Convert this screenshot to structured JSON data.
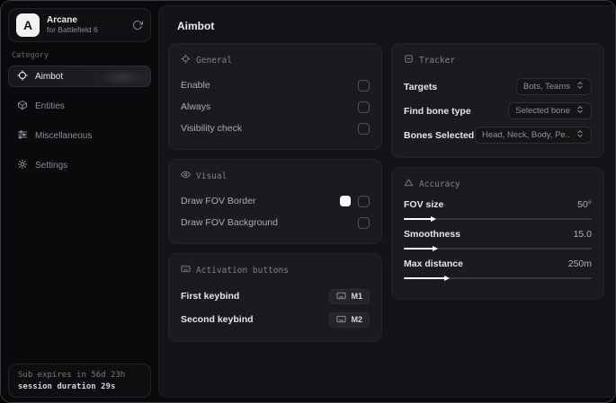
{
  "app": {
    "logo_letter": "A",
    "name": "Arcane",
    "subtitle": "for Battlefield 6"
  },
  "sidebar": {
    "category_label": "Category",
    "items": [
      {
        "label": "Aimbot",
        "icon": "crosshair-icon",
        "active": true
      },
      {
        "label": "Entities",
        "icon": "entities-icon",
        "active": false
      },
      {
        "label": "Miscellaneous",
        "icon": "sliders-icon",
        "active": false
      },
      {
        "label": "Settings",
        "icon": "gear-icon",
        "active": false
      }
    ],
    "footer": {
      "line1": "Sub expires in 56d 23h",
      "line2": "session duration 29s"
    }
  },
  "main": {
    "title": "Aimbot",
    "cards": {
      "general": {
        "title": "General",
        "rows": [
          {
            "label": "Enable",
            "control": "checkbox",
            "checked": false
          },
          {
            "label": "Always",
            "control": "checkbox",
            "checked": false
          },
          {
            "label": "Visibility check",
            "control": "checkbox",
            "checked": false
          }
        ]
      },
      "visual": {
        "title": "Visual",
        "rows": [
          {
            "label": "Draw FOV Border",
            "control": "color+checkbox",
            "color": "#ffffff",
            "checked": false
          },
          {
            "label": "Draw FOV Background",
            "control": "checkbox",
            "checked": false
          }
        ]
      },
      "activation": {
        "title": "Activation buttons",
        "rows": [
          {
            "label": "First keybind",
            "key": "M1"
          },
          {
            "label": "Second keybind",
            "key": "M2"
          }
        ]
      },
      "tracker": {
        "title": "Tracker",
        "rows": [
          {
            "label": "Targets",
            "value": "Bots, Teams"
          },
          {
            "label": "Find bone type",
            "value": "Selected bone"
          },
          {
            "label": "Bones Selected",
            "value": "Head, Neck, Body, Pe.."
          }
        ]
      },
      "accuracy": {
        "title": "Accuracy",
        "sliders": [
          {
            "label": "FOV size",
            "value": "50°",
            "percent": 15
          },
          {
            "label": "Smoothness",
            "value": "15.0",
            "percent": 16
          },
          {
            "label": "Max distance",
            "value": "250m",
            "percent": 22
          }
        ]
      }
    }
  },
  "colors": {
    "accent_swatch": "#ffffff",
    "panel": "#1a1a1f",
    "background": "#0a0a0c"
  }
}
